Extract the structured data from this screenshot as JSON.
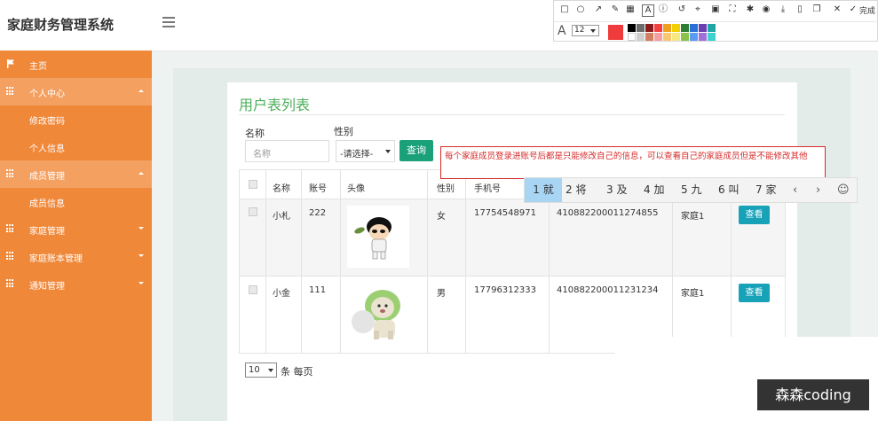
{
  "app": {
    "title": "家庭财务管理系统"
  },
  "avatar": {
    "text": "80x80"
  },
  "sidebar": {
    "items": [
      {
        "label": "主页"
      },
      {
        "label": "个人中心"
      },
      {
        "label": "修改密码"
      },
      {
        "label": "个人信息"
      },
      {
        "label": "成员管理"
      },
      {
        "label": "成员信息"
      },
      {
        "label": "家庭管理"
      },
      {
        "label": "家庭账本管理"
      },
      {
        "label": "通知管理"
      }
    ]
  },
  "panel": {
    "title": "用户表列表"
  },
  "search": {
    "name_label": "名称",
    "name_placeholder": "名称",
    "sex_label": "性别",
    "sex_selected": "-请选择-",
    "query_label": "查询"
  },
  "table": {
    "headers": [
      "名称",
      "账号",
      "头像",
      "性别",
      "手机号",
      "",
      "",
      ""
    ],
    "rows": [
      {
        "name": "小札",
        "account": "222",
        "sex": "女",
        "phone": "17754548971",
        "id": "410882200011274855",
        "family": "家庭1",
        "action": "查看"
      },
      {
        "name": "小金",
        "account": "111",
        "sex": "男",
        "phone": "17796312333",
        "id": "410882200011231234",
        "family": "家庭1",
        "action": "查看"
      }
    ]
  },
  "pagination": {
    "page_size": "10",
    "label": "条 每页"
  },
  "note": {
    "text": "每个家庭成员登录进账号后都是只能修改自己的信息，可以查看自己的家庭成员但是不能修改其他"
  },
  "ime": {
    "candidates": [
      "1 就",
      "2 将",
      "3 及",
      "4 加",
      "5 九",
      "6 叫",
      "7 家"
    ],
    "prev": "‹",
    "next": "›",
    "emoji": "☺"
  },
  "toolbar": {
    "done_label": "完成",
    "font_size": "12",
    "current_color": "#ef3b3b",
    "colors": [
      "#000000",
      "#6b6b6b",
      "#8b1a1a",
      "#f04040",
      "#f0a020",
      "#f0d000",
      "#2e7d32",
      "#2a6fd6",
      "#6a3fb0",
      "#1fa5a5",
      "#ffffff",
      "#cfcfcf",
      "#d08060",
      "#f4a0a0",
      "#f8c870",
      "#f8e880",
      "#8bc34a",
      "#5b9bf0",
      "#a070d8",
      "#40d0d0"
    ]
  },
  "watermark": {
    "text": "森森coding"
  }
}
